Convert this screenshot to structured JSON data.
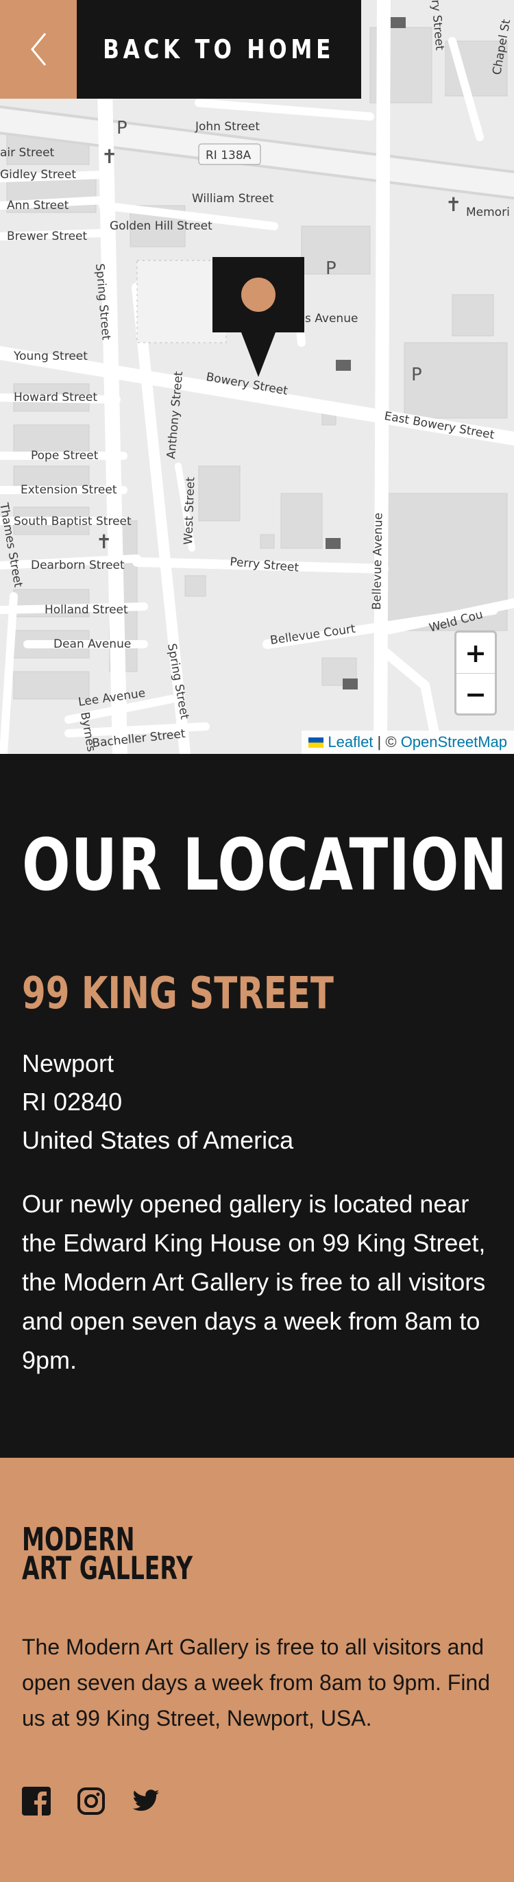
{
  "nav": {
    "back_label": "BACK TO HOME",
    "back_icon": "chevron-left-icon"
  },
  "map": {
    "zoom_in": "+",
    "zoom_out": "−",
    "attribution": {
      "leaflet": "Leaflet",
      "separator": " | © ",
      "osm": "OpenStreetMap"
    },
    "streets": [
      "John Street",
      "RI 138A",
      "air Street",
      "Gidley Street",
      "William Street",
      "Golden Hill Street",
      "Memori",
      "Ann Street",
      "Brewer Street",
      "Spring Street",
      "s Avenue",
      "Young Street",
      "Bowery Street",
      "Howard Street",
      "Anthony Street",
      "East Bowery Street",
      "Pope Street",
      "Extension Street",
      "South Baptist Street",
      "West Street",
      "Thames Street",
      "Dearborn Street",
      "Perry Street",
      "Bellevue Avenue",
      "Holland Street",
      "Dean Avenue",
      "Bellevue Court",
      "Weld Cou",
      "Spring Street",
      "Lee Avenue",
      "Byrnes",
      "Bacheller Street",
      "ry Street",
      "Chapel St"
    ],
    "marker_icon": "map-pin-icon"
  },
  "location": {
    "title": "OUR LOCATION",
    "street": "99 KING STREET",
    "address_lines": [
      "Newport",
      "RI 02840",
      "United States of America"
    ],
    "description": "Our newly opened gallery is located near the Edward King House on 99 King Street, the Modern Art Gallery is free to all visitors and open seven days a week from 8am to 9pm."
  },
  "footer": {
    "logo_line1": "MODERN",
    "logo_line2": "ART GALLERY",
    "text": "The Modern Art Gallery is free to all visitors and open seven days a week from 8am to 9pm. Find us at 99 King Street, Newport, USA.",
    "social": [
      "facebook-icon",
      "instagram-icon",
      "twitter-icon"
    ]
  },
  "colors": {
    "accent": "#d3956b",
    "dark": "#151515",
    "map_bg": "#ececec",
    "link": "#0078a8"
  }
}
